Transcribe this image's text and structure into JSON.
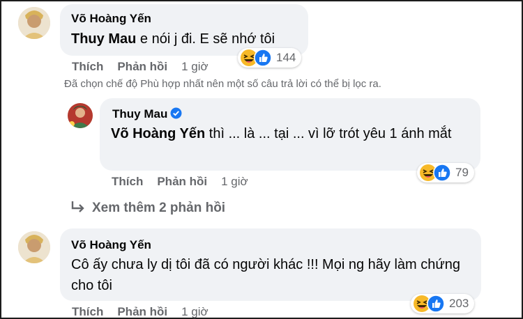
{
  "comments": [
    {
      "author": "Võ Hoàng Yến",
      "mention": "Thuy Mau",
      "text": " e nói j đi. E sẽ nhớ tôi",
      "reaction_count": "144",
      "actions": {
        "like": "Thích",
        "reply": "Phản hồi",
        "time": "1 giờ"
      }
    },
    {
      "author": "Thuy Mau",
      "mention": "Võ Hoàng Yến",
      "text": " thì ... là ... tại ... vì lỡ trót yêu 1 ánh mắt",
      "reaction_count": "79",
      "actions": {
        "like": "Thích",
        "reply": "Phản hồi",
        "time": "1 giờ"
      }
    },
    {
      "author": "Võ Hoàng Yến",
      "text": "Cô ấy chưa ly dị tôi đã có người khác !!! Mọi ng hãy làm chứng cho tôi",
      "reaction_count": "203",
      "actions": {
        "like": "Thích",
        "reply": "Phản hồi",
        "time": "1 giờ"
      }
    }
  ],
  "filter_notice": "Đã chọn chế độ Phù hợp nhất nên một số câu trả lời có thể bị lọc ra.",
  "view_more": "Xem thêm 2 phản hồi",
  "colors": {
    "bubble": "#f0f2f5",
    "like_blue": "#1877f2",
    "haha_yellow": "#f7b928",
    "secondary_text": "#65676b"
  }
}
